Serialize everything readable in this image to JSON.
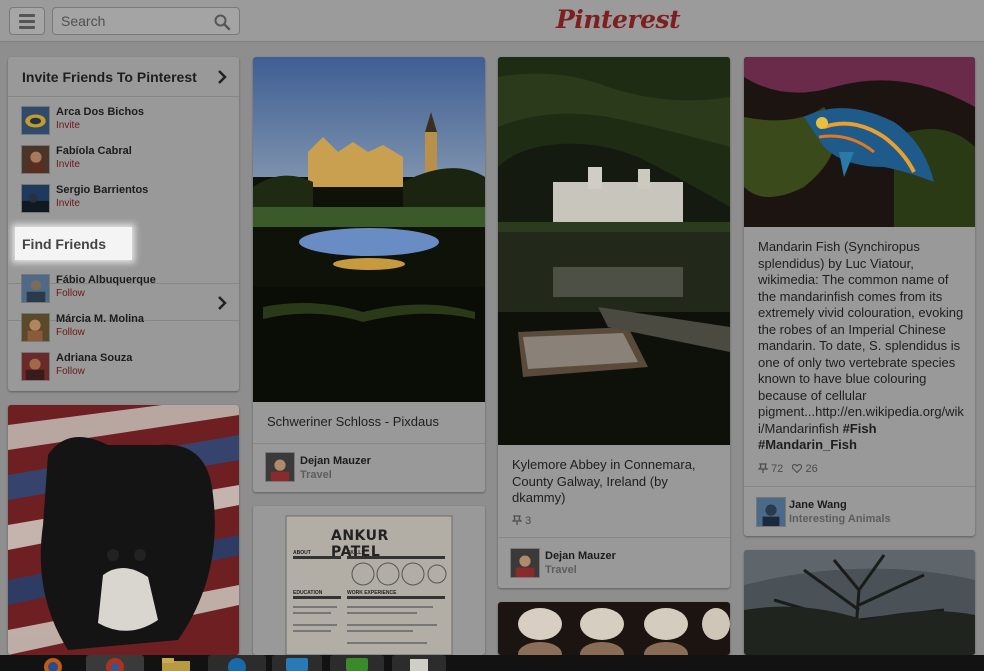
{
  "header": {
    "search_placeholder": "Search",
    "logo_text": "Pinterest"
  },
  "invite": {
    "heading": "Invite Friends To Pinterest",
    "people": [
      {
        "name": "Arca Dos Bichos",
        "action": "Invite"
      },
      {
        "name": "Fabíola Cabral",
        "action": "Invite"
      },
      {
        "name": "Sergio Barrientos",
        "action": "Invite"
      }
    ]
  },
  "find": {
    "heading": "Find Friends",
    "people": [
      {
        "name": "Fábio Albuquerque",
        "action": "Follow"
      },
      {
        "name": "Márcia M. Molina",
        "action": "Follow"
      },
      {
        "name": "Adriana Souza",
        "action": "Follow"
      }
    ]
  },
  "pins": {
    "schwerin": {
      "description": "Schweriner Schloss - Pixdaus",
      "pinner": "Dejan Mauzer",
      "board": "Travel"
    },
    "kylemore": {
      "description_lines": [
        "Kylemore Abbey in Connemara,",
        "County Galway, Ireland (by",
        "dkammy)"
      ],
      "repins": "3",
      "pinner": "Dejan Mauzer",
      "board": "Travel"
    },
    "mandarin": {
      "description_lines": [
        "Mandarin Fish (Synchiropus",
        "splendidus) by Luc Viatour,",
        "wikimedia: The common name of",
        "the mandarinfish comes from its",
        "extremely vivid colouration, evoking",
        "the robes of an Imperial Chinese",
        "mandarin. To date, S. splendidus is",
        "one of only two vertebrate species",
        "known to have blue colouring",
        "because of cellular",
        "pigment...http://en.wikipedia.org/wik",
        "i/Mandarinfish"
      ],
      "hashtag_1": "#Fish",
      "hashtag_2": "#Mandarin_Fish",
      "repins": "72",
      "likes": "26",
      "pinner": "Jane Wang",
      "board": "Interesting Animals"
    },
    "resume": {
      "name": "ANKUR PATEL",
      "sections": [
        "ABOUT",
        "SKILLS",
        "EDUCATION",
        "WORK EXPERIENCE"
      ]
    }
  },
  "icons": {
    "menu": "hamburger-icon",
    "search": "magnifier-icon",
    "chevron": "chevron-right-icon",
    "repin": "pin-icon",
    "like": "heart-icon"
  },
  "colors": {
    "brand": "#7d1f1f",
    "action_link": "#6b1818",
    "highlight": "#f4f4f4"
  }
}
